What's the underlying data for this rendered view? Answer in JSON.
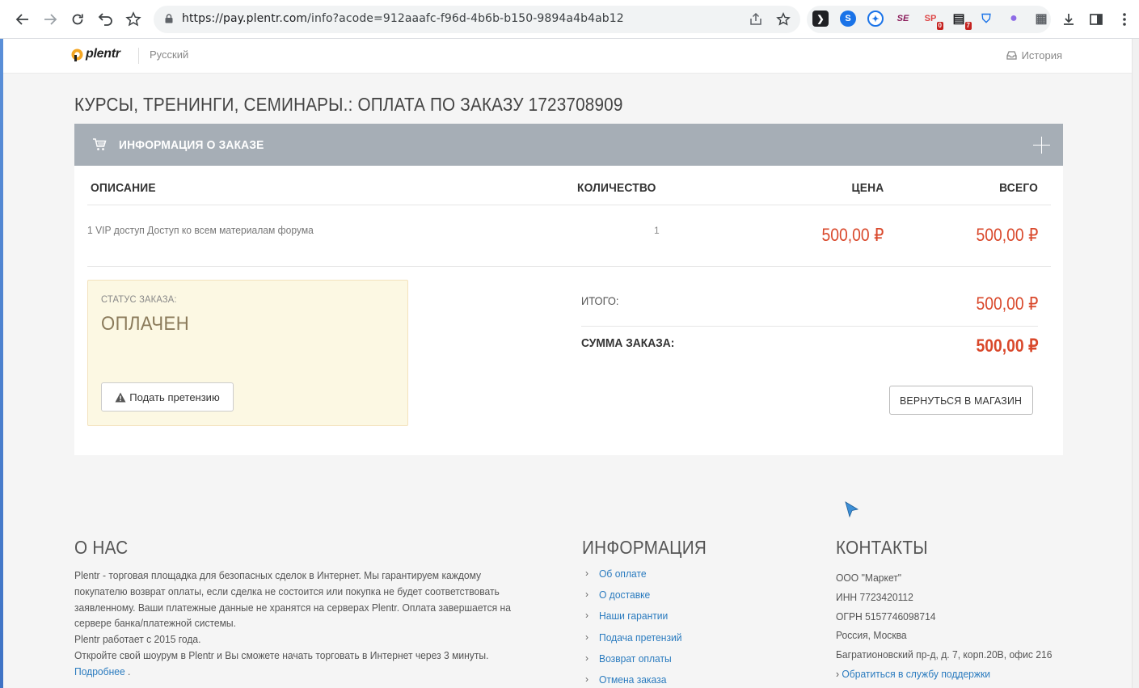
{
  "browser": {
    "url_host": "https://pay.plentr.com",
    "url_path": "/info?acode=912aaafc-f96d-4b6b-b150-9894a4b4ab12",
    "extensions": [
      {
        "name": "terminal-extension-icon",
        "color": "#202124",
        "glyph": "❯"
      },
      {
        "name": "sync-extension-icon",
        "color": "#1a73e8",
        "glyph": "S"
      },
      {
        "name": "compass-extension-icon",
        "color": "#1a73e8",
        "glyph": "◉"
      },
      {
        "name": "se-extension-icon",
        "color": "#ffffff",
        "glyph": "SE"
      },
      {
        "name": "sp-extension-icon",
        "color": "#ffffff",
        "glyph": "SP",
        "badge": "0"
      },
      {
        "name": "filter-extension-icon",
        "color": "#202124",
        "glyph": "▤",
        "badge": "7"
      },
      {
        "name": "vpn-extension-icon",
        "color": "#1a73e8",
        "glyph": "V"
      },
      {
        "name": "drop-extension-icon",
        "color": "#8e6be6",
        "glyph": "●"
      },
      {
        "name": "grid-extension-icon",
        "color": "#5f6368",
        "glyph": "▦"
      }
    ]
  },
  "header": {
    "logo_text": "plentr",
    "language": "Русский",
    "history_label": "История"
  },
  "page_title": "КУРСЫ, ТРЕНИНГИ, СЕМИНАРЫ.: ОПЛАТА ПО ЗАКАЗУ 1723708909",
  "order_panel": {
    "title": "ИНФОРМАЦИЯ О ЗАКАЗЕ",
    "columns": [
      "ОПИСАНИЕ",
      "КОЛИЧЕСТВО",
      "ЦЕНА",
      "ВСЕГО"
    ],
    "items": [
      {
        "description": "1 VIP доступ Доступ ко всем материалам форума",
        "quantity": "1",
        "price": "500,00 ₽",
        "total": "500,00 ₽"
      }
    ],
    "status_label": "СТАТУС ЗАКАЗА:",
    "status_value": "ОПЛАЧЕН",
    "claim_button": "Подать претензию",
    "subtotal_label": "ИТОГО:",
    "subtotal_value": "500,00 ₽",
    "order_sum_label": "СУММА ЗАКАЗА:",
    "order_sum_value": "500,00 ₽",
    "back_button": "ВЕРНУТЬСЯ В МАГАЗИН"
  },
  "footer": {
    "about": {
      "title": "О НАС",
      "lines": [
        "Plentr - торговая площадка для безопасных сделок в Интернет. Мы гарантируем каждому",
        "покупателю возврат оплаты, если сделка не состоится или покупка не будет соответствовать",
        "заявленному. Ваши платежные данные не хранятся на серверах Plentr. Оплата завершается на",
        "сервере банка/платежной системы.",
        "Plentr работает с 2015 года.",
        "Откройте свой шоурум в Plentr и Вы сможете начать торговать в Интернет через 3 минуты."
      ],
      "more_link": "Подробнее",
      "more_suffix": " ."
    },
    "info": {
      "title": "ИНФОРМАЦИЯ",
      "links": [
        "Об оплате",
        "О доставке",
        "Наши гарантии",
        "Подача претензий",
        "Возврат оплаты",
        "Отмена заказа"
      ]
    },
    "contacts": {
      "title": "КОНТАКТЫ",
      "lines": [
        "ООО \"Маркет\"",
        "ИНН 7723420112",
        "ОГРН 5157746098714",
        "Россия, Москва",
        "Багратионовский пр-д, д. 7, корп.20В, офис 216"
      ],
      "support_link": "Обратиться в службу поддержки"
    }
  },
  "colors": {
    "accent_price": "#d9482b",
    "panel_header": "#a6aeb6",
    "status_bg": "#fcf8e3",
    "link": "#2a7bbf"
  }
}
